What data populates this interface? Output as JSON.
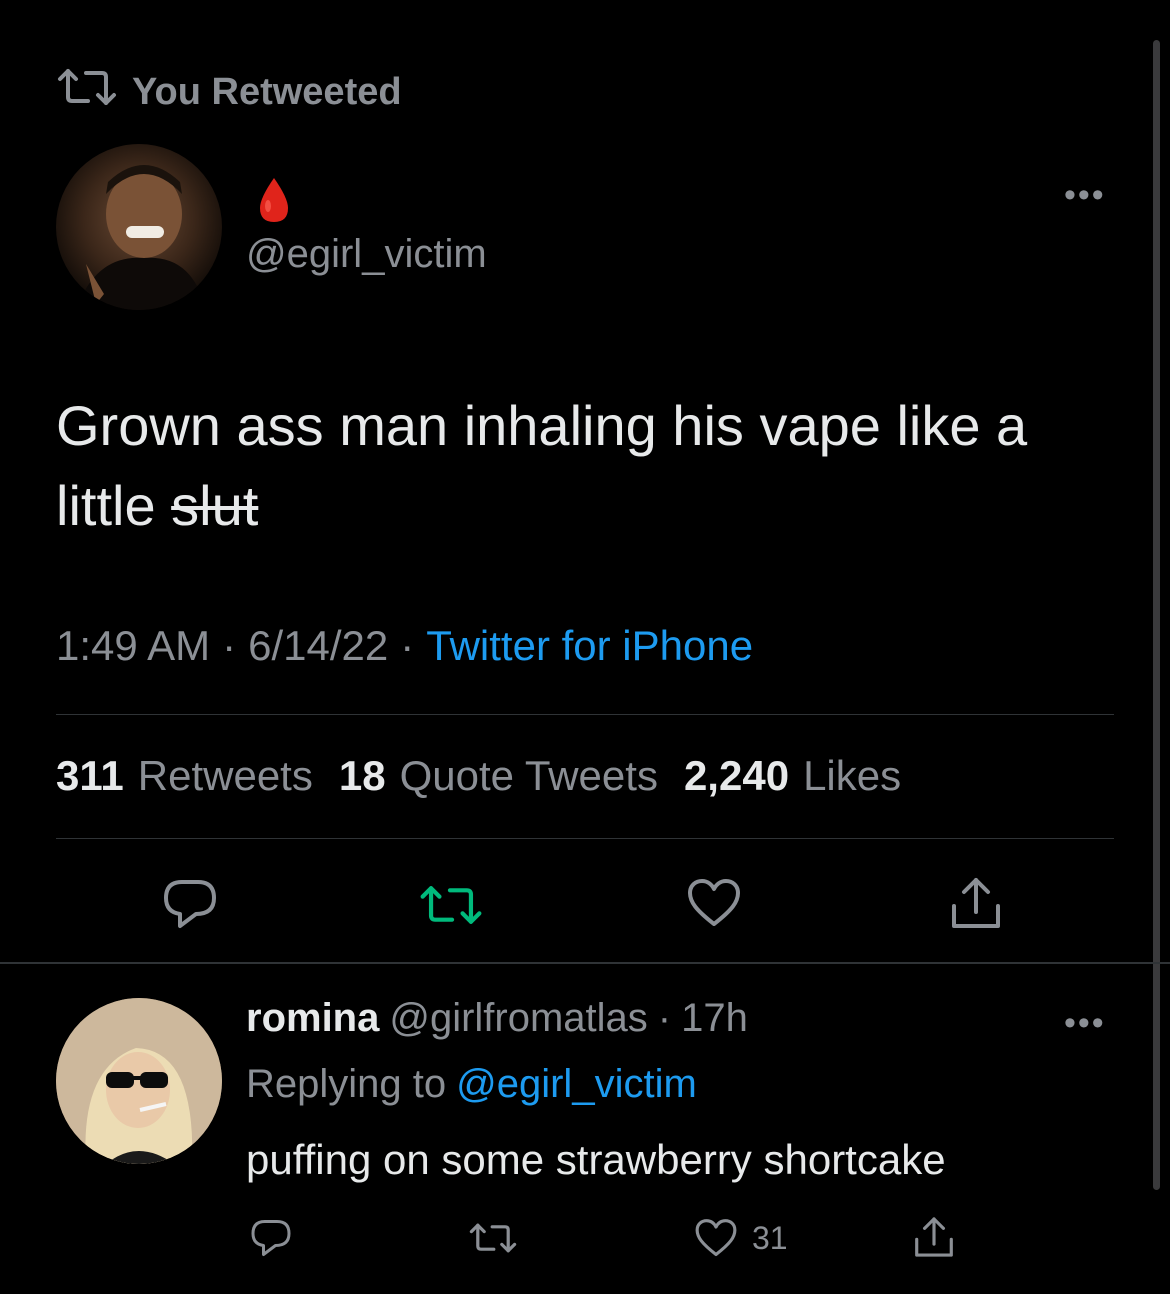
{
  "retweet_banner": {
    "label": "You Retweeted"
  },
  "tweet": {
    "author_handle": "@egirl_victim",
    "text_main": "Grown ass man inhaling his vape like a little",
    "text_struck": "slut",
    "time": "1:49 AM",
    "date": "6/14/22",
    "source": "Twitter for iPhone",
    "separator": "·",
    "stats": {
      "retweets_count": "311",
      "retweets_label": "Retweets",
      "quotes_count": "18",
      "quotes_label": "Quote Tweets",
      "likes_count": "2,240",
      "likes_label": "Likes"
    }
  },
  "reply": {
    "name": "romina",
    "handle": "@girlfromatlas",
    "separator": "·",
    "age": "17h",
    "replying_prefix": "Replying to",
    "replying_to": "@egirl_victim",
    "text": "puffing on some strawberry shortcake",
    "like_count": "31"
  },
  "colors": {
    "background": "#000000",
    "text_primary": "#e7e9ea",
    "text_secondary": "#8b8f95",
    "link": "#1d9bf0",
    "retweet_active": "#00ba7c",
    "drop": "#e0241b"
  },
  "icons": [
    "retweet-icon",
    "blood-drop-icon",
    "more-icon",
    "reply-icon",
    "like-icon",
    "share-icon"
  ]
}
